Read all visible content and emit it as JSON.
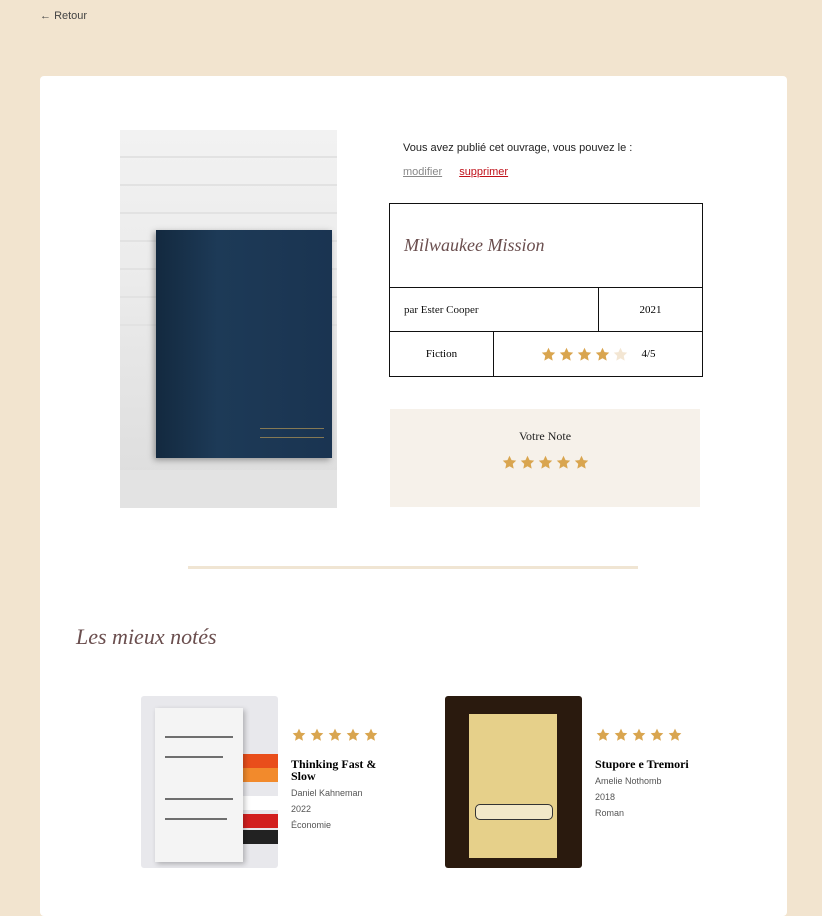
{
  "nav": {
    "back_label": "Retour",
    "back_icon": "arrow-left-icon"
  },
  "owner": {
    "text": "Vous avez publié cet ouvrage, vous pouvez le :",
    "edit_label": "modifier",
    "delete_label": "supprimer"
  },
  "book": {
    "title": "Milwaukee Mission",
    "author": "par Ester Cooper",
    "year": "2021",
    "genre": "Fiction",
    "rating": 4,
    "rating_max": 5,
    "rating_text": "4/5"
  },
  "your_note": {
    "label": "Votre Note",
    "value": 5
  },
  "top_rated": {
    "title": "Les mieux notés",
    "books": [
      {
        "title": "Thinking Fast & Slow",
        "author": "Daniel Kahneman",
        "year": "2022",
        "genre": "Économie",
        "rating": 5
      },
      {
        "title": "Stupore e Tremori",
        "author": "Amelie Nothomb",
        "year": "2018",
        "genre": "Roman",
        "rating": 5
      }
    ]
  },
  "colors": {
    "star_filled": "#d9a54f",
    "star_empty": "#f3e6d3",
    "background": "#f2e4cf",
    "accent_title": "#6a4e4e",
    "delete_link": "#c0111a"
  }
}
